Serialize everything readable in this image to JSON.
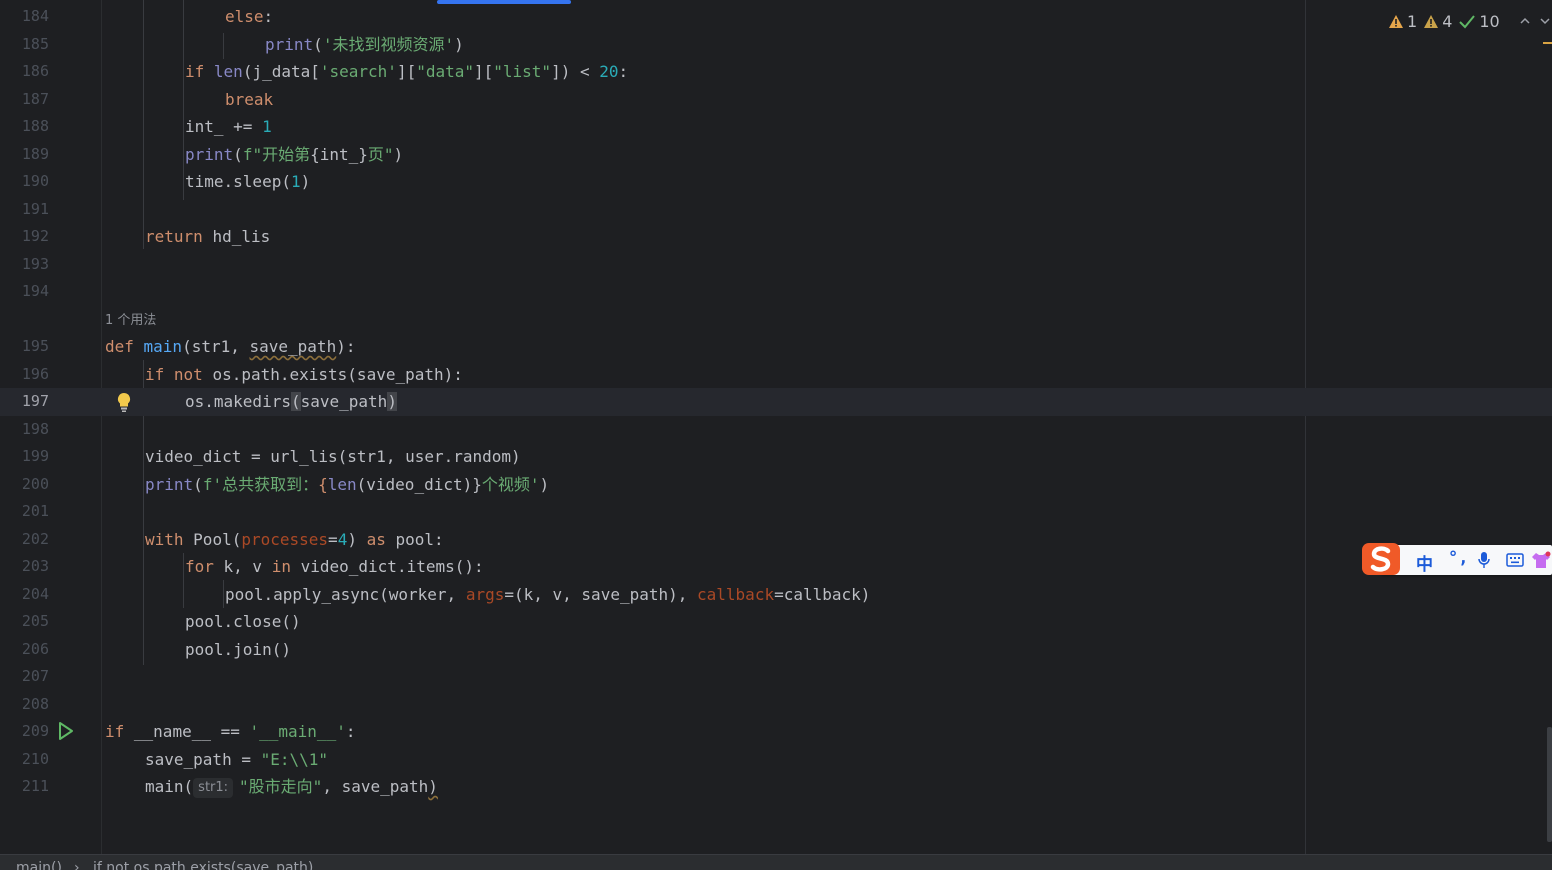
{
  "inspections": {
    "errors": "1",
    "warnings": "4",
    "weak": "10"
  },
  "usage_hint": "1 个用法",
  "inlay_hint": "str1:",
  "breadcrumb": {
    "fn": "main()",
    "sep": "›",
    "stmt": "if not os.path.exists(save_path)"
  },
  "ime": {
    "lang": "中",
    "punct": "°,"
  },
  "lines": [
    {
      "n": "184"
    },
    {
      "n": "185"
    },
    {
      "n": "186"
    },
    {
      "n": "187"
    },
    {
      "n": "188"
    },
    {
      "n": "189"
    },
    {
      "n": "190"
    },
    {
      "n": "191"
    },
    {
      "n": "192"
    },
    {
      "n": "193"
    },
    {
      "n": "194"
    },
    {
      "n": "195"
    },
    {
      "n": "196"
    },
    {
      "n": "197"
    },
    {
      "n": "198"
    },
    {
      "n": "199"
    },
    {
      "n": "200"
    },
    {
      "n": "201"
    },
    {
      "n": "202"
    },
    {
      "n": "203"
    },
    {
      "n": "204"
    },
    {
      "n": "205"
    },
    {
      "n": "206"
    },
    {
      "n": "207"
    },
    {
      "n": "208"
    },
    {
      "n": "209"
    },
    {
      "n": "210"
    },
    {
      "n": "211"
    }
  ],
  "code": {
    "l184": {
      "kw": "else",
      "p": ":"
    },
    "l185": {
      "fn": "print",
      "a": "(",
      "s": "'未找到视频资源'",
      "b": ")"
    },
    "l186": {
      "kw": "if ",
      "bi": "len",
      "a": "(j_data[",
      "s1": "'search'",
      "b": "][",
      "s2": "\"data\"",
      "c": "][",
      "s3": "\"list\"",
      "d": "]) < ",
      "num": "20",
      "e": ":"
    },
    "l187": {
      "kw": "break"
    },
    "l188": {
      "a": "int_ += ",
      "num": "1"
    },
    "l189": {
      "fn": "print",
      "a": "(",
      "s1": "f\"开始第",
      "b": "{int_}",
      "s2": "页\"",
      "c": ")"
    },
    "l190": {
      "a": "time.sleep(",
      "num": "1",
      "b": ")"
    },
    "l192": {
      "kw": "return ",
      "a": "hd_lis"
    },
    "l195": {
      "kw": "def ",
      "fn": "main",
      "a": "(str1, ",
      "p": "save_path",
      "b": "):"
    },
    "l196": {
      "kw": "if not ",
      "a": "os.path.exists(save_path):"
    },
    "l197": {
      "a": "os.makedirs",
      "b": "(",
      "c": "save_path",
      "d": ")"
    },
    "l199": {
      "a": "video_dict = url_lis(str1, user.random)"
    },
    "l200": {
      "fn": "print",
      "a": "(",
      "s1": "f'总共获取到：",
      "b": "{",
      "bi": "len",
      "c": "(video_dict)}",
      "s2": "个视频'",
      "d": ")"
    },
    "l202": {
      "kw1": "with ",
      "a": "Pool(",
      "pa": "processes",
      "b": "=",
      "num": "4",
      "c": ") ",
      "kw2": "as ",
      "d": "pool:"
    },
    "l203": {
      "kw1": "for ",
      "a": "k, v ",
      "kw2": "in ",
      "b": "video_dict.items():"
    },
    "l204": {
      "a": "pool.apply_async(worker, ",
      "pa1": "args",
      "b": "=(k, v, save_path), ",
      "pa2": "callback",
      "c": "=callback)"
    },
    "l205": {
      "a": "pool.close()"
    },
    "l206": {
      "a": "pool.join()"
    },
    "l209": {
      "kw": "if ",
      "a": "__name__ == ",
      "s": "'__main__'",
      "b": ":"
    },
    "l210": {
      "a": "save_path = ",
      "s": "\"E:\\\\1\""
    },
    "l211": {
      "a": "main(",
      "s": "\"股市走向\"",
      "b": ", save_path",
      "c": ")"
    }
  }
}
